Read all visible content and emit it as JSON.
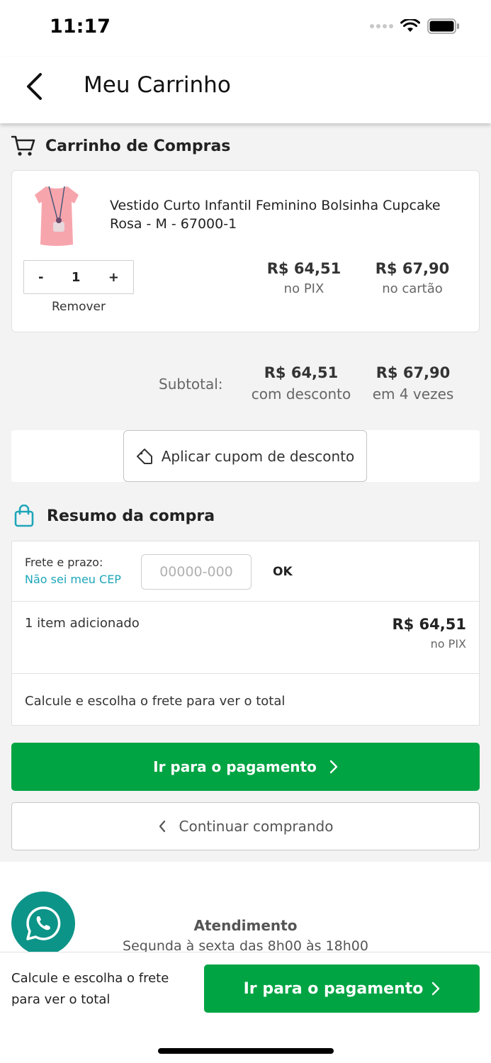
{
  "status_bar": {
    "time": "11:17"
  },
  "nav": {
    "title": "Meu Carrinho"
  },
  "cart_section": {
    "title": "Carrinho de Compras"
  },
  "product": {
    "name": "Vestido Curto Infantil Feminino Bolsinha Cupcake Rosa - M - 67000-1",
    "quantity": "1",
    "minus_label": "-",
    "plus_label": "+",
    "remove_label": "Remover",
    "price_pix": "R$ 64,51",
    "price_pix_label": "no PIX",
    "price_card": "R$ 67,90",
    "price_card_label": "no cartão"
  },
  "subtotal": {
    "label": "Subtotal:",
    "discount_value": "R$ 64,51",
    "discount_label": "com desconto",
    "installments_value": "R$ 67,90",
    "installments_label": "em 4 vezes"
  },
  "coupon": {
    "button_label": "Aplicar cupom de desconto"
  },
  "summary_section": {
    "title": "Resumo da compra"
  },
  "shipping": {
    "label": "Frete e prazo:",
    "cep_link": "Não sei meu CEP",
    "cep_placeholder": "00000-000",
    "cep_value": "",
    "ok_label": "OK"
  },
  "items": {
    "label": "1 item adicionado",
    "value": "R$ 64,51",
    "value_label": "no PIX"
  },
  "total_note": "Calcule e escolha o frete para ver o total",
  "actions": {
    "checkout_label": "Ir para o pagamento",
    "continue_label": "Continuar comprando"
  },
  "footer": {
    "support_title": "Atendimento",
    "support_hours": "Segunda à sexta das 8h00 às 18h00"
  },
  "bottom_bar": {
    "note": "Calcule e escolha o frete para ver o total",
    "checkout_label": "Ir para o pagamento"
  },
  "colors": {
    "primary_green": "#00a443",
    "link_teal": "#1ea6b8",
    "whatsapp_teal": "#0d9488"
  },
  "icons": [
    "back-chevron-icon",
    "cart-icon",
    "tag-icon",
    "bag-icon",
    "chevron-right-icon",
    "chevron-left-icon",
    "whatsapp-icon",
    "wifi-icon",
    "battery-icon",
    "signal-icon"
  ]
}
